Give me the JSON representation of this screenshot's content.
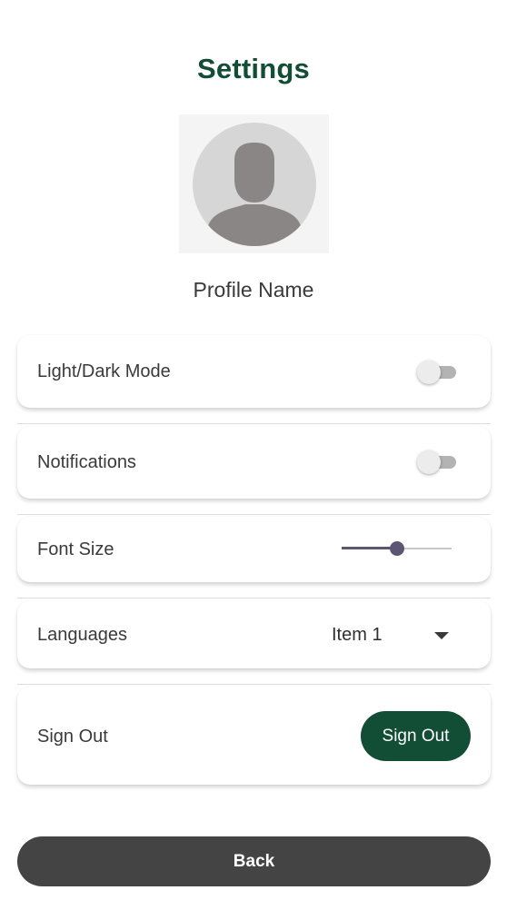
{
  "header": {
    "title": "Settings"
  },
  "profile": {
    "avatar_icon": "person-silhouette-icon",
    "name": "Profile Name"
  },
  "settings": {
    "theme": {
      "label": "Light/Dark Mode",
      "enabled": false
    },
    "notifications": {
      "label": "Notifications",
      "enabled": false
    },
    "font_size": {
      "label": "Font Size",
      "value_fraction": 0.5
    },
    "languages": {
      "label": "Languages",
      "selected": "Item 1",
      "icon": "caret-down-icon"
    },
    "sign_out": {
      "label": "Sign Out",
      "button_label": "Sign Out"
    }
  },
  "footer": {
    "back_label": "Back"
  },
  "colors": {
    "brand_green": "#124d35",
    "back_button": "#444444",
    "slider_accent": "#5c5574"
  }
}
